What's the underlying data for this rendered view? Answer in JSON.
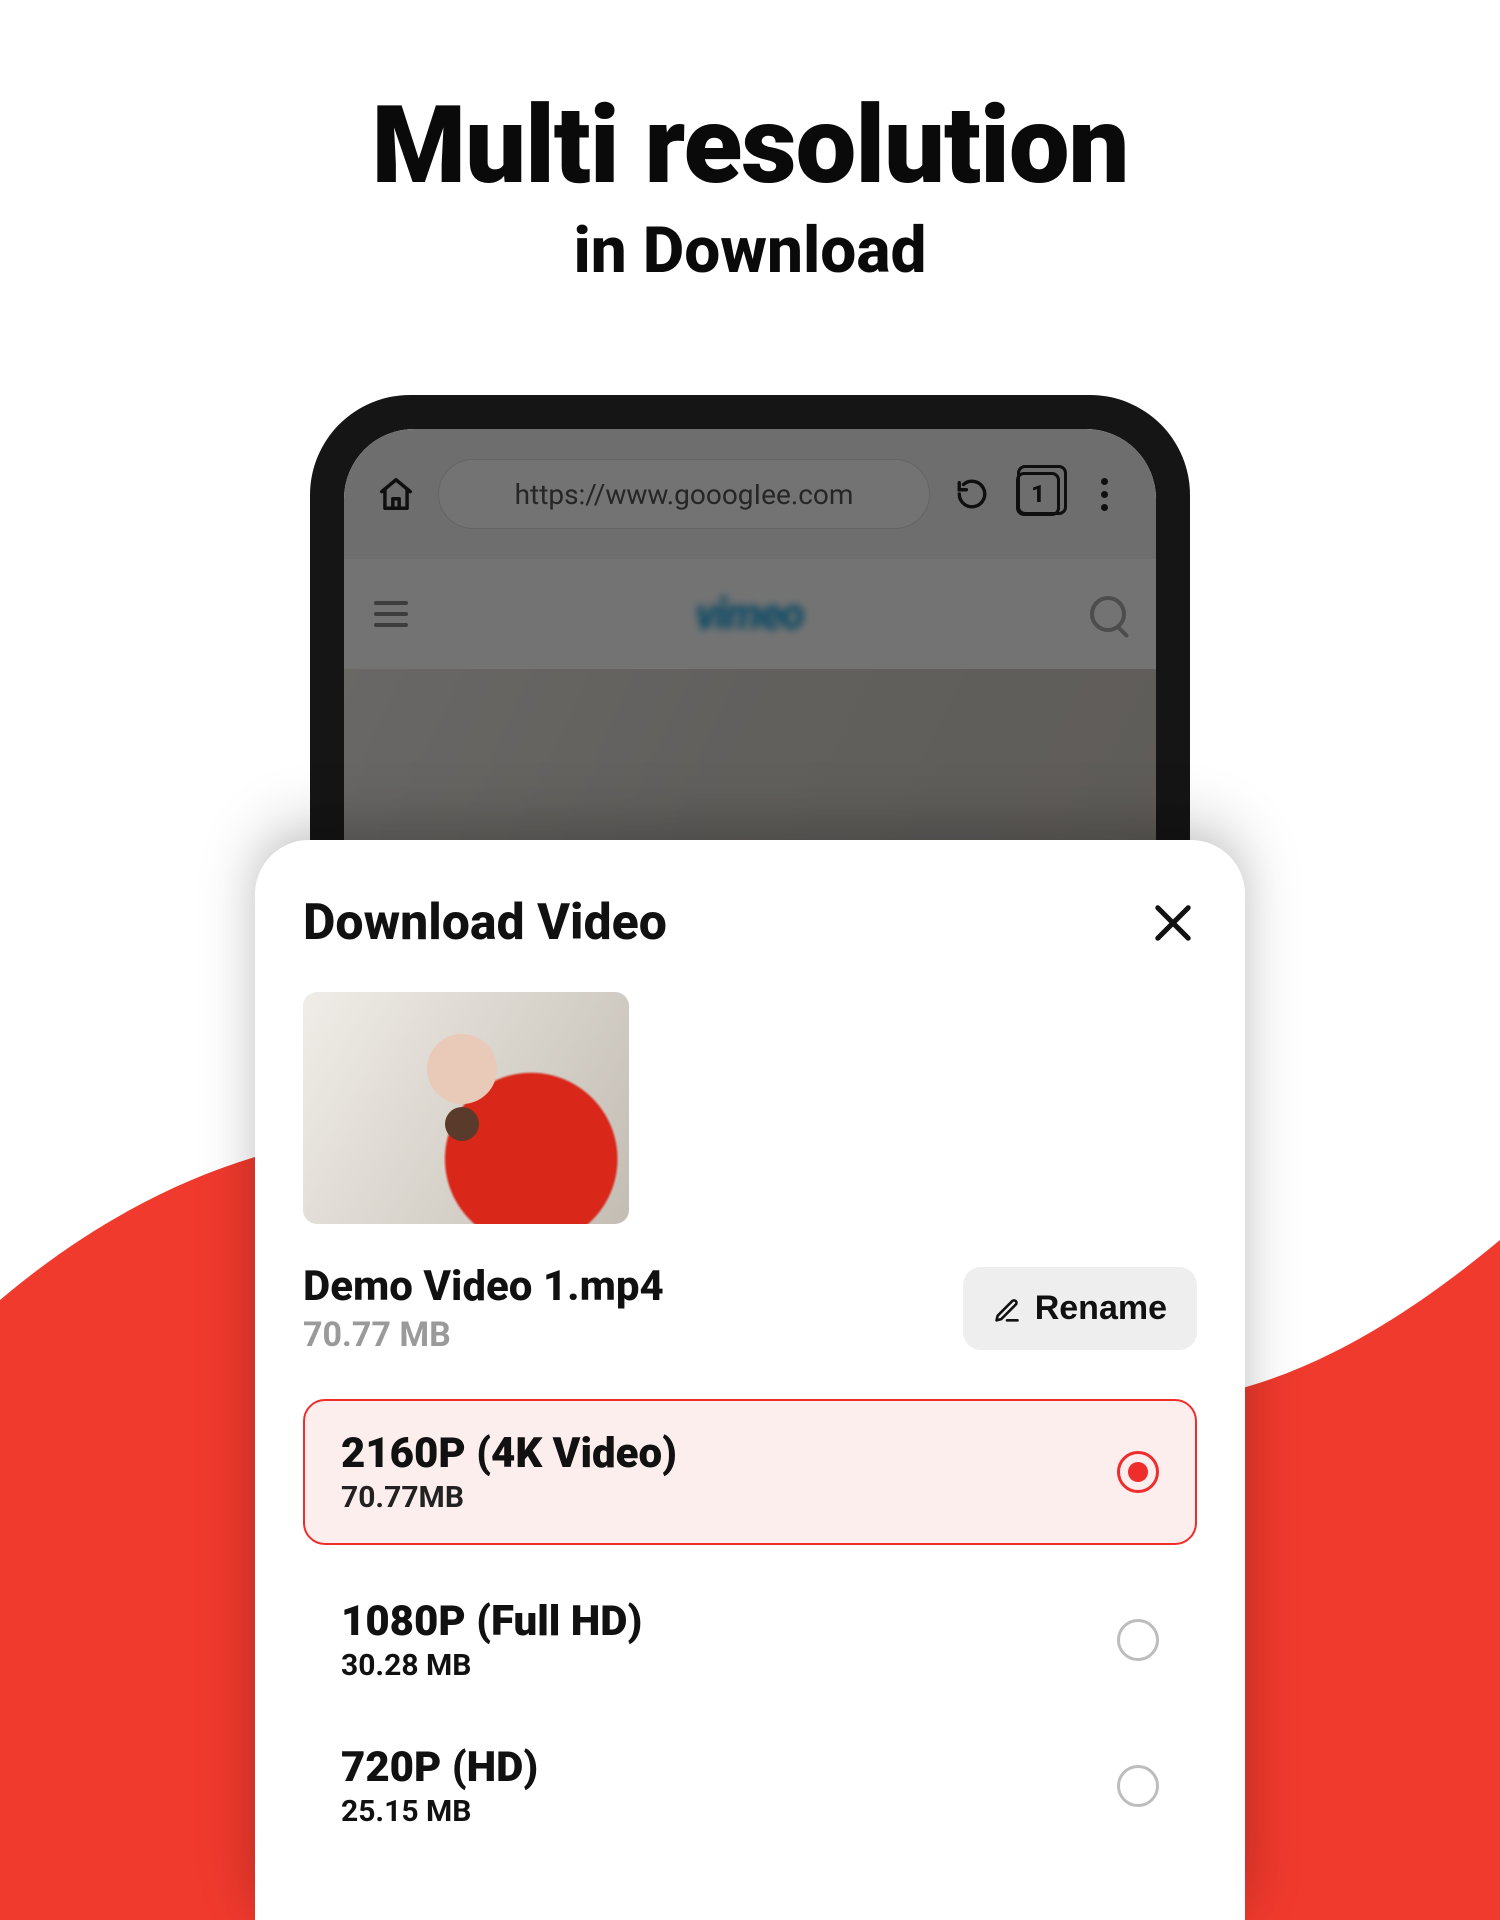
{
  "marketing": {
    "title": "Multi resolution",
    "subtitle": "in Download"
  },
  "browser": {
    "url": "https://www.gooogIee.com",
    "tab_count": "1",
    "brand": "vimeo"
  },
  "sheet": {
    "title": "Download Video",
    "file_name": "Demo Video 1.mp4",
    "file_size": "70.77 MB",
    "rename_label": "Rename",
    "options": [
      {
        "label": "2160P (4K Video)",
        "size": "70.77MB",
        "selected": true
      },
      {
        "label": "1080P (Full HD)",
        "size": "30.28 MB",
        "selected": false
      },
      {
        "label": "720P (HD)",
        "size": "25.15 MB",
        "selected": false
      }
    ]
  },
  "colors": {
    "accent": "#ef2d2d"
  }
}
